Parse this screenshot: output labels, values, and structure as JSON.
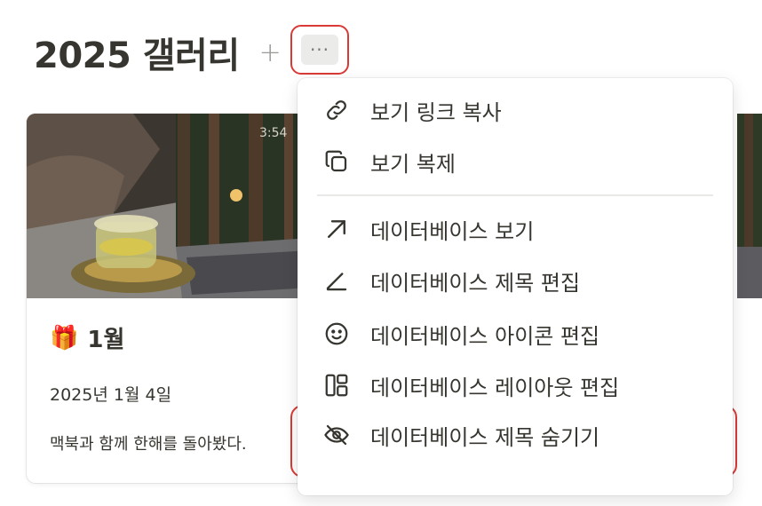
{
  "page": {
    "title": "2025 갤러리",
    "add_label": "+",
    "more_label": "···"
  },
  "cover": {
    "clock": "3:54"
  },
  "card": {
    "emoji": "🎁",
    "name": "1월",
    "date": "2025년 1월 4일",
    "description": "맥북과 함께 한해를 돌아봤다."
  },
  "menu": {
    "items": [
      {
        "label": "보기 링크 복사",
        "icon": "link-icon"
      },
      {
        "label": "보기 복제",
        "icon": "duplicate-icon"
      },
      {
        "label": "데이터베이스 보기",
        "icon": "arrow-up-right-icon"
      },
      {
        "label": "데이터베이스 제목 편집",
        "icon": "pencil-icon"
      },
      {
        "label": "데이터베이스 아이콘 편집",
        "icon": "smiley-icon"
      },
      {
        "label": "데이터베이스 레이아웃 편집",
        "icon": "layout-icon"
      },
      {
        "label": "데이터베이스 제목 숨기기",
        "icon": "eye-slash-icon"
      }
    ]
  },
  "colors": {
    "highlight_red": "#d93a35",
    "highlight_blue": "#4a8ad9",
    "text": "#37352f"
  }
}
